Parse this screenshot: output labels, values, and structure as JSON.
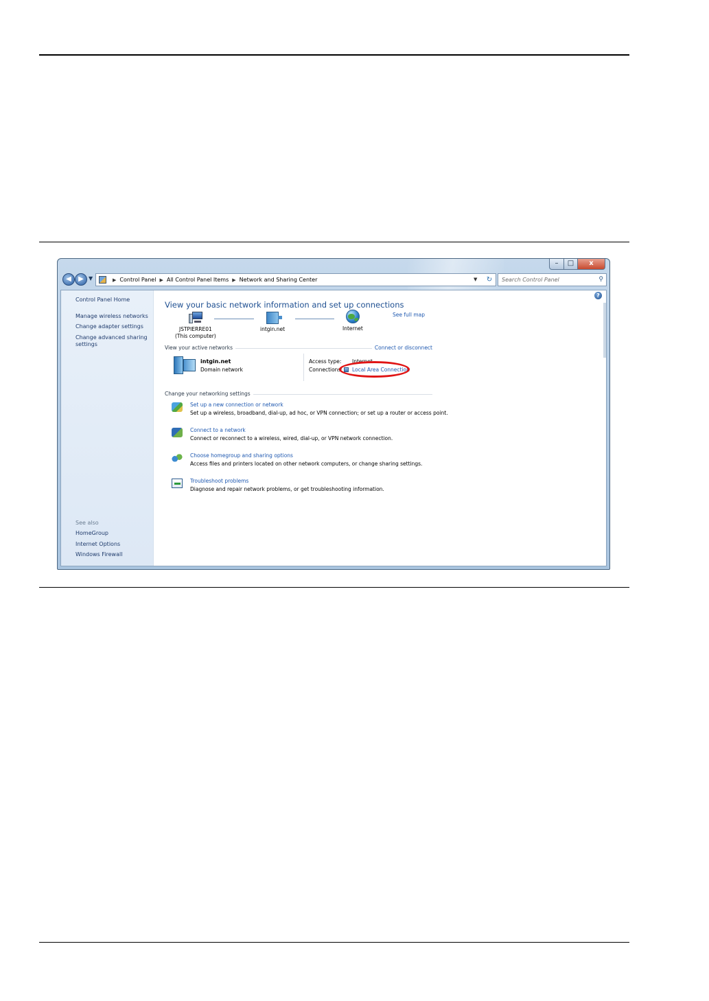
{
  "window": {
    "caption_buttons": {
      "minimize": "–",
      "maximize": "□",
      "close": "x"
    }
  },
  "address_bar": {
    "breadcrumb": [
      "Control Panel",
      "All Control Panel Items",
      "Network and Sharing Center"
    ],
    "search_placeholder": "Search Control Panel",
    "icons": [
      "back-icon",
      "forward-icon",
      "recent-pages-icon",
      "control-panel-icon",
      "refresh-icon",
      "search-icon"
    ]
  },
  "sidebar": {
    "home": "Control Panel Home",
    "links": [
      "Manage wireless networks",
      "Change adapter settings",
      "Change advanced sharing",
      "settings"
    ],
    "see_also_label": "See also",
    "see_also": [
      "HomeGroup",
      "Internet Options",
      "Windows Firewall"
    ]
  },
  "main": {
    "title": "View your basic network information and set up connections",
    "see_full_map": "See full map",
    "map": {
      "computer_name": "JSTPIERRE01",
      "computer_sub": "(This computer)",
      "network": "intgin.net",
      "internet": "Internet"
    },
    "active_networks": {
      "label": "View your active networks",
      "connect_link": "Connect or disconnect",
      "network_name": "intgin.net",
      "network_category": "Domain network",
      "access_type_label": "Access type:",
      "access_type_value": "Internet",
      "connections_label": "Connections:",
      "connection_link": "Local Area Connection"
    },
    "settings_label": "Change your networking settings",
    "tasks": [
      {
        "title": "Set up a new connection or network",
        "desc": "Set up a wireless, broadband, dial-up, ad hoc, or VPN connection; or set up a router or access point."
      },
      {
        "title": "Connect to a network",
        "desc": "Connect or reconnect to a wireless, wired, dial-up, or VPN network connection."
      },
      {
        "title": "Choose homegroup and sharing options",
        "desc": "Access files and printers located on other network computers, or change sharing settings."
      },
      {
        "title": "Troubleshoot problems",
        "desc": "Diagnose and repair network problems, or get troubleshooting information."
      }
    ]
  },
  "colors": {
    "link": "#1e58b0",
    "title": "#1e4f91",
    "highlight_oval": "#e01414",
    "sidebar_bg": "#e8f0f9"
  }
}
